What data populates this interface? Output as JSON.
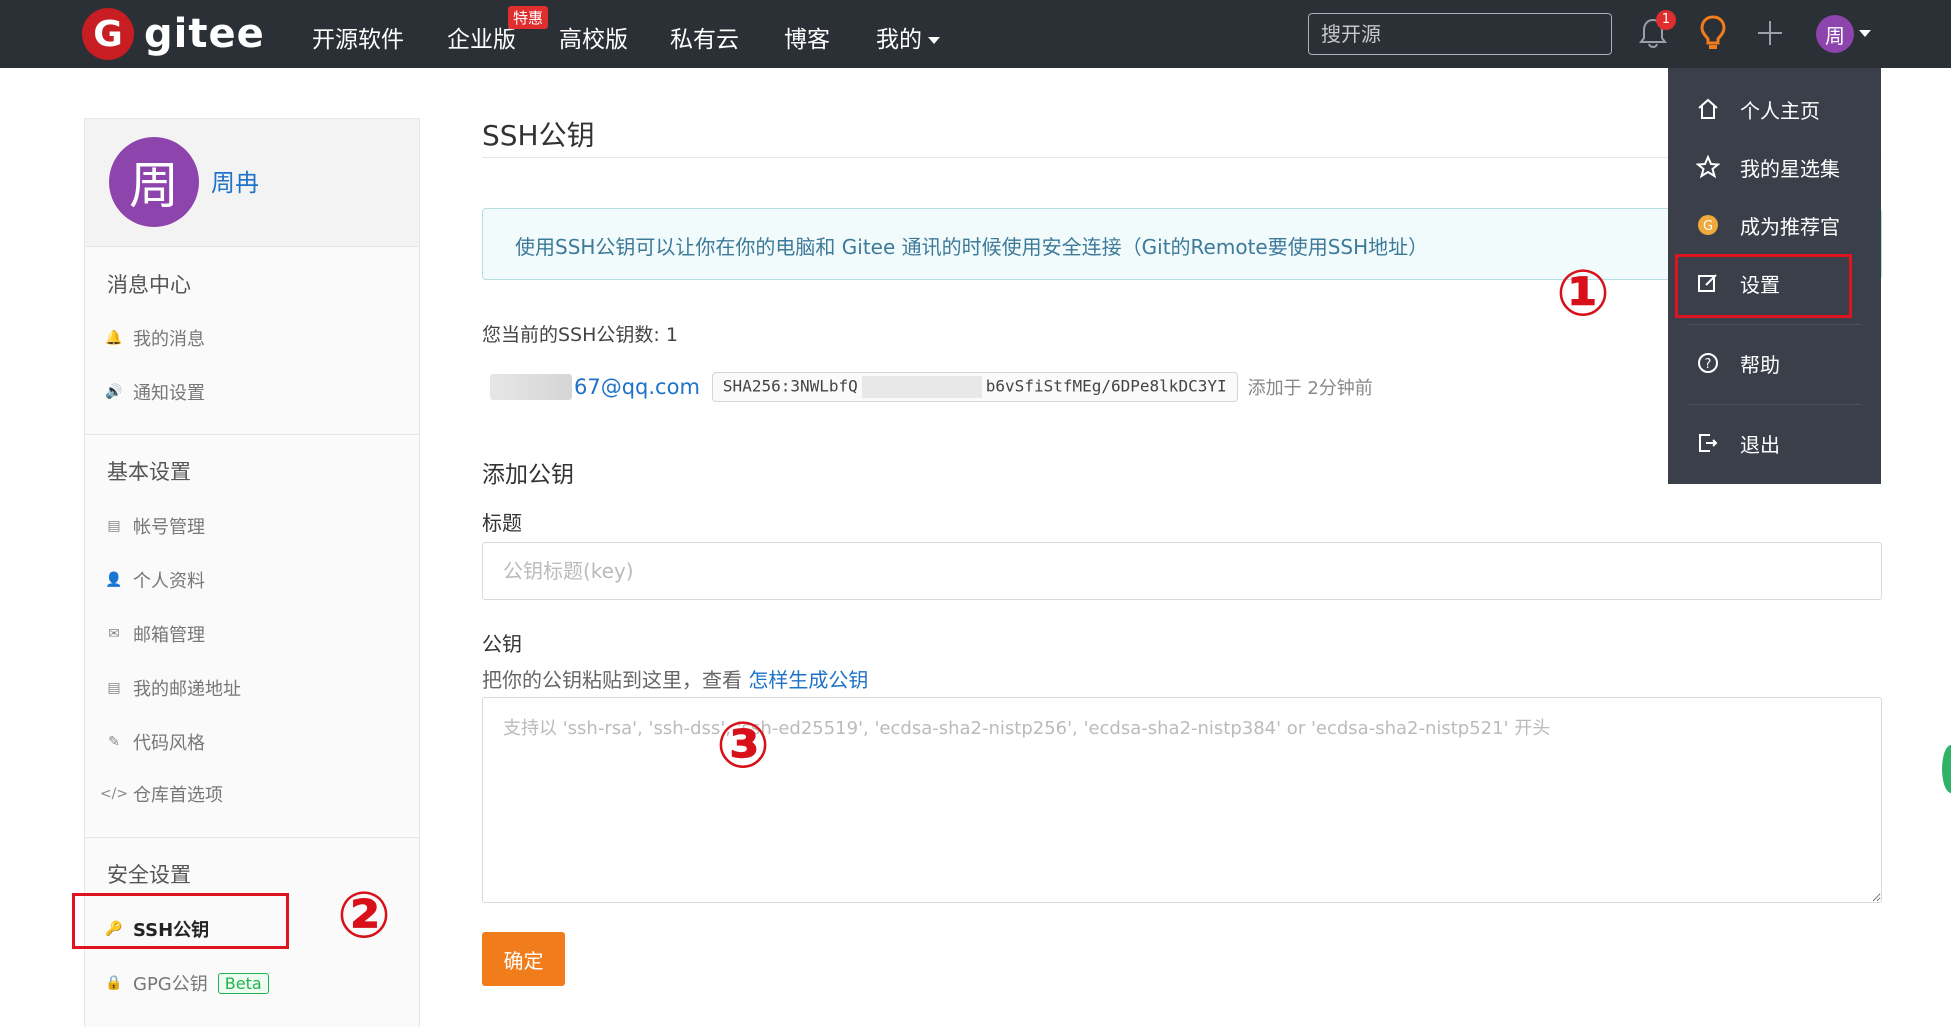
{
  "navbar": {
    "logo_letter": "G",
    "logo_text": "gitee",
    "items": [
      {
        "label": "开源软件"
      },
      {
        "label": "企业版"
      },
      {
        "label": "高校版"
      },
      {
        "label": "私有云"
      },
      {
        "label": "博客"
      },
      {
        "label": "我的"
      }
    ],
    "badge_label": "特惠",
    "search_placeholder": "搜开源",
    "notification_count": "1",
    "avatar_letter": "周"
  },
  "dropdown": {
    "items": [
      {
        "label": "个人主页",
        "icon": "home-icon"
      },
      {
        "label": "我的星选集",
        "icon": "star-icon"
      },
      {
        "label": "成为推荐官",
        "icon": "gitee-coin-icon"
      },
      {
        "label": "设置",
        "icon": "edit-icon"
      },
      {
        "label": "帮助",
        "icon": "help-icon"
      },
      {
        "label": "退出",
        "icon": "logout-icon"
      }
    ]
  },
  "sidebar": {
    "avatar_letter": "周",
    "user_name": "周冉",
    "sections": [
      {
        "title": "消息中心",
        "items": [
          {
            "label": "我的消息",
            "icon": "bell-icon"
          },
          {
            "label": "通知设置",
            "icon": "speaker-icon"
          }
        ]
      },
      {
        "title": "基本设置",
        "items": [
          {
            "label": "帐号管理",
            "icon": "id-card-icon"
          },
          {
            "label": "个人资料",
            "icon": "user-icon"
          },
          {
            "label": "邮箱管理",
            "icon": "mail-icon"
          },
          {
            "label": "我的邮递地址",
            "icon": "address-card-icon"
          },
          {
            "label": "代码风格",
            "icon": "brush-icon"
          },
          {
            "label": "仓库首选项",
            "icon": "code-icon"
          }
        ]
      },
      {
        "title": "安全设置",
        "items": [
          {
            "label": "SSH公钥",
            "icon": "key-icon"
          },
          {
            "label": "GPG公钥",
            "icon": "lock-icon",
            "badge": "Beta"
          }
        ]
      }
    ]
  },
  "main": {
    "title": "SSH公钥",
    "info_text": "使用SSH公钥可以让你在你的电脑和 Gitee 通讯的时候使用安全连接（Git的Remote要使用SSH地址）",
    "key_count_text": "您当前的SSH公钥数: 1",
    "key": {
      "email": "67@qq.com",
      "fingerprint_start": "SHA256:3NWLbfQ",
      "fingerprint_end": "b6vSfiStfMEg/6DPe8lkDC3YI",
      "added_text": "添加于 2分钟前"
    },
    "add_title": "添加公钥",
    "title_label": "标题",
    "title_placeholder": "公钥标题(key)",
    "key_label": "公钥",
    "hint_text": "把你的公钥粘贴到这里，查看",
    "hint_link": "怎样生成公钥",
    "key_placeholder": "支持以 'ssh-rsa', 'ssh-dss', 'ssh-ed25519', 'ecdsa-sha2-nistp256', 'ecdsa-sha2-nistp384' or 'ecdsa-sha2-nistp521' 开头",
    "submit_label": "确定"
  },
  "annotations": [
    "①",
    "②",
    "③"
  ],
  "colors": {
    "navbar_bg": "#2b2f36",
    "brand_red": "#c71d23",
    "link_blue": "#1e73c8",
    "submit_orange": "#f07c1b",
    "annotation_red": "#e0141e",
    "dropdown_bg": "#3a3f4a"
  }
}
